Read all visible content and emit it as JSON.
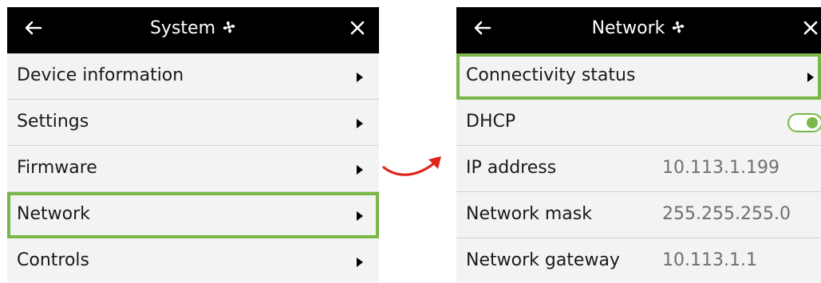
{
  "left_panel": {
    "title": "System",
    "title_icon": "fan-icon",
    "back_icon": "back-arrow-icon",
    "close_icon": "close-icon",
    "items": [
      {
        "label": "Device information"
      },
      {
        "label": "Settings"
      },
      {
        "label": "Firmware"
      },
      {
        "label": "Network",
        "highlighted": true
      },
      {
        "label": "Controls"
      }
    ]
  },
  "right_panel": {
    "title": "Network",
    "title_icon": "fan-icon",
    "back_icon": "back-arrow-icon",
    "close_icon": "close-icon",
    "connectivity": {
      "label": "Connectivity status",
      "highlighted": true
    },
    "dhcp": {
      "label": "DHCP",
      "enabled": true
    },
    "ip": {
      "label": "IP address",
      "value": "10.113.1.199"
    },
    "mask": {
      "label": "Network mask",
      "value": "255.255.255.0"
    },
    "gateway": {
      "label": "Network gateway",
      "value": "10.113.1.1"
    }
  },
  "colors": {
    "header_bg": "#000000",
    "panel_bg": "#f3f3f3",
    "highlight": "#7ab648",
    "transition_arrow": "#e0261b",
    "value_text": "#6f6f6f"
  }
}
